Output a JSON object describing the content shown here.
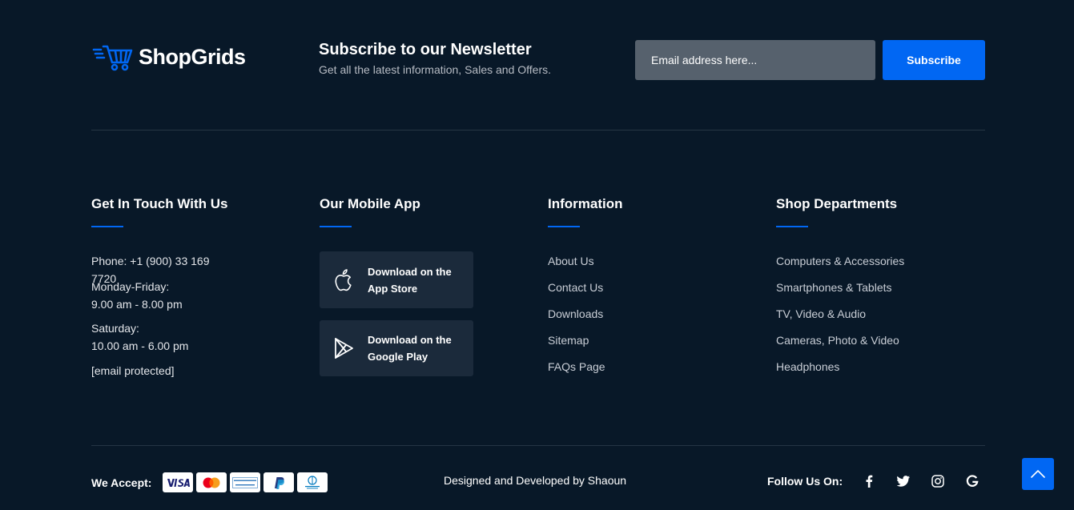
{
  "brand": {
    "name": "ShopGrids",
    "accent_color": "#0167f3",
    "background_color": "#081828"
  },
  "newsletter": {
    "title": "Subscribe to our Newsletter",
    "subtitle": "Get all the latest information, Sales and Offers.",
    "email_placeholder": "Email address here...",
    "button_label": "Subscribe"
  },
  "contact": {
    "title": "Get In Touch With Us",
    "phone": "Phone: +1 (900) 33 169 7720",
    "weekday_label": "Monday-Friday:",
    "weekday_hours": "9.00 am - 8.00 pm",
    "saturday_label": "Saturday:",
    "saturday_hours": "10.00 am - 6.00 pm",
    "email": "[email protected]"
  },
  "mobile_app": {
    "title": "Our Mobile App",
    "apps": [
      {
        "line1": "Download on the",
        "line2": "App Store",
        "icon": "apple-icon"
      },
      {
        "line1": "Download on the",
        "line2": "Google Play",
        "icon": "play-store-icon"
      }
    ]
  },
  "information": {
    "title": "Information",
    "links": [
      "About Us",
      "Contact Us",
      "Downloads",
      "Sitemap",
      "FAQs Page"
    ]
  },
  "departments": {
    "title": "Shop Departments",
    "links": [
      "Computers & Accessories",
      "Smartphones & Tablets",
      "TV, Video & Audio",
      "Cameras, Photo & Video",
      "Headphones"
    ]
  },
  "bottom": {
    "accept_label": "We Accept:",
    "payment_cards": [
      "visa-card-icon",
      "mastercard-icon",
      "american-express-icon",
      "paypal-icon",
      "diners-club-icon"
    ],
    "credit": "Designed and Developed by Shaoun",
    "follow_label": "Follow Us On:",
    "socials": [
      "facebook-icon",
      "twitter-icon",
      "instagram-icon",
      "google-icon"
    ]
  }
}
